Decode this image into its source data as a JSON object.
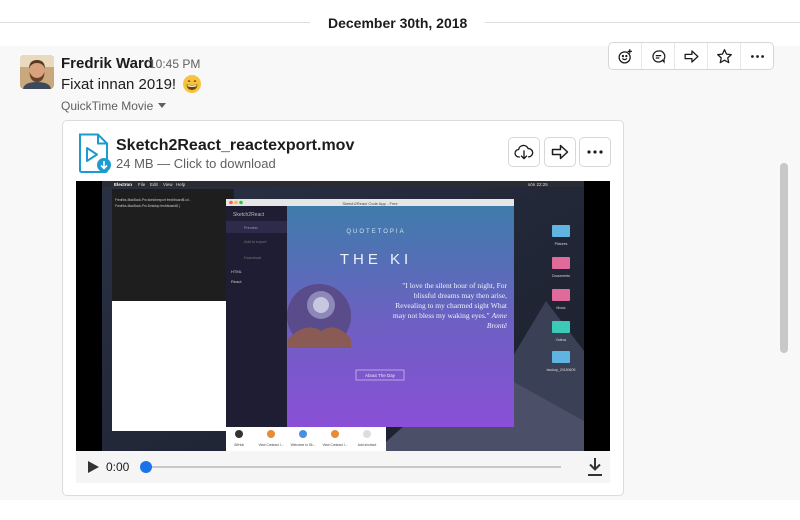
{
  "date_divider": {
    "label": "December 30th, 2018"
  },
  "message": {
    "sender": "Fredrik Ward",
    "timestamp": "10:45 PM",
    "text": "Fixat innan 2019!",
    "emoji": "grinning-face",
    "file_type_label": "QuickTime Movie"
  },
  "actions": [
    "add-reaction-icon",
    "reply-thread-icon",
    "share-icon",
    "star-icon",
    "more-icon"
  ],
  "file": {
    "name": "Sketch2React_reactexport.mov",
    "meta": "24 MB — Click to download",
    "icon": "video-file-icon"
  },
  "video_frame": {
    "menu_app": "Electron",
    "menu_items": [
      "File",
      "Edit",
      "View",
      "Help"
    ],
    "menu_clock": "sön 22:25",
    "window_title": "Sketch2React Code App - Free",
    "sidebar_title": "Sketch2React",
    "sidebar_items": [
      "Preview",
      "Add to export",
      "Download",
      "HTML",
      "React"
    ],
    "preview_brand": "QUOTETOPIA",
    "preview_heading": "THE KI",
    "quote_text": "\"I love the silent hour of night, For blissful dreams may then arise, Revealing to my charmed sight What may not bless my waking eyes.\"",
    "quote_author": "Anne Brontë",
    "quote_button": "About The Day",
    "desktop_icons": [
      "Pictures",
      "Documents",
      "Music",
      "Videos",
      "backup_20180605"
    ],
    "dock_items": [
      "GitHub",
      "View Contract I...",
      "Welcome to Sk...",
      "View Contract I...",
      "Add shortcut"
    ],
    "terminal_lines": [
      "Fredriks-MacBook-Pro:sketchexport fredrikward$ cd ..",
      "Fredriks-MacBook-Pro:Desktop fredrikward$ |"
    ]
  },
  "player": {
    "time": "0:00",
    "progress": 0
  },
  "colors": {
    "accent": "#1a73e8",
    "file_icon": "#1d9bd1"
  }
}
